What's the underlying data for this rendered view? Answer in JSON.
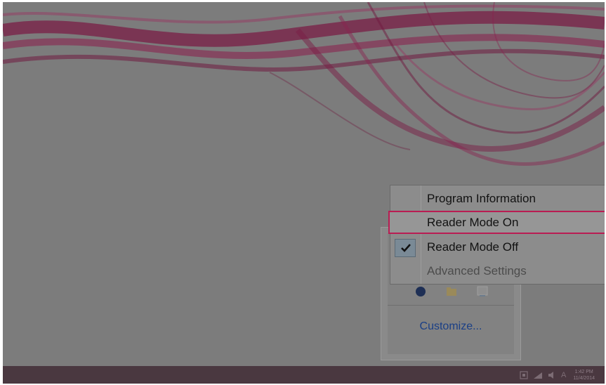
{
  "context_menu": {
    "items": [
      {
        "label": "Program Information",
        "checked": false,
        "enabled": true,
        "highlighted": false
      },
      {
        "label": "Reader Mode On",
        "checked": false,
        "enabled": true,
        "highlighted": true
      },
      {
        "label": "Reader Mode Off",
        "checked": true,
        "enabled": true,
        "highlighted": false
      },
      {
        "label": "Advanced Settings",
        "checked": false,
        "enabled": false,
        "highlighted": false
      }
    ],
    "highlight_color": "#b91c52"
  },
  "tray_overflow": {
    "customize_label": "Customize...",
    "icons": [
      "circle-app-icon",
      "folder-app-icon",
      "network-app-icon"
    ]
  },
  "taskbar": {
    "tray_icons": [
      "action-center-icon",
      "network-icon",
      "volume-icon"
    ],
    "ime_indicator": "A",
    "clock_time": "1:42 PM",
    "clock_date": "11/4/2014"
  },
  "colors": {
    "desktop_dim": "#7c7c7c",
    "wallpaper_accent": "#8a1f4c",
    "taskbar": "#4a3840",
    "link": "#1a3f86"
  }
}
